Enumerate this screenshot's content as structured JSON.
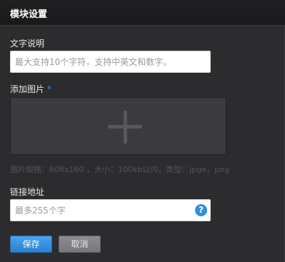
{
  "header": {
    "title": "模块设置"
  },
  "form": {
    "text_desc": {
      "label": "文字说明",
      "value": "",
      "placeholder": "最大支持10个字符，支持中英文和数字。"
    },
    "image": {
      "label": "添加图片",
      "required_mark": "*",
      "upload_icon": "plus-icon",
      "hint": "图片规格：608x160 ，大小：100kb以内，类型：jpge，png"
    },
    "link": {
      "label": "链接地址",
      "value": "",
      "placeholder": "最多255个字",
      "help_icon": "question-circle-icon",
      "help_glyph": "?"
    }
  },
  "buttons": {
    "save": "保存",
    "cancel": "取消"
  },
  "colors": {
    "accent": "#2f8fe0",
    "background": "#2c2c2f",
    "header": "#1c1c1e",
    "dropzone": "#3b3b3f"
  }
}
